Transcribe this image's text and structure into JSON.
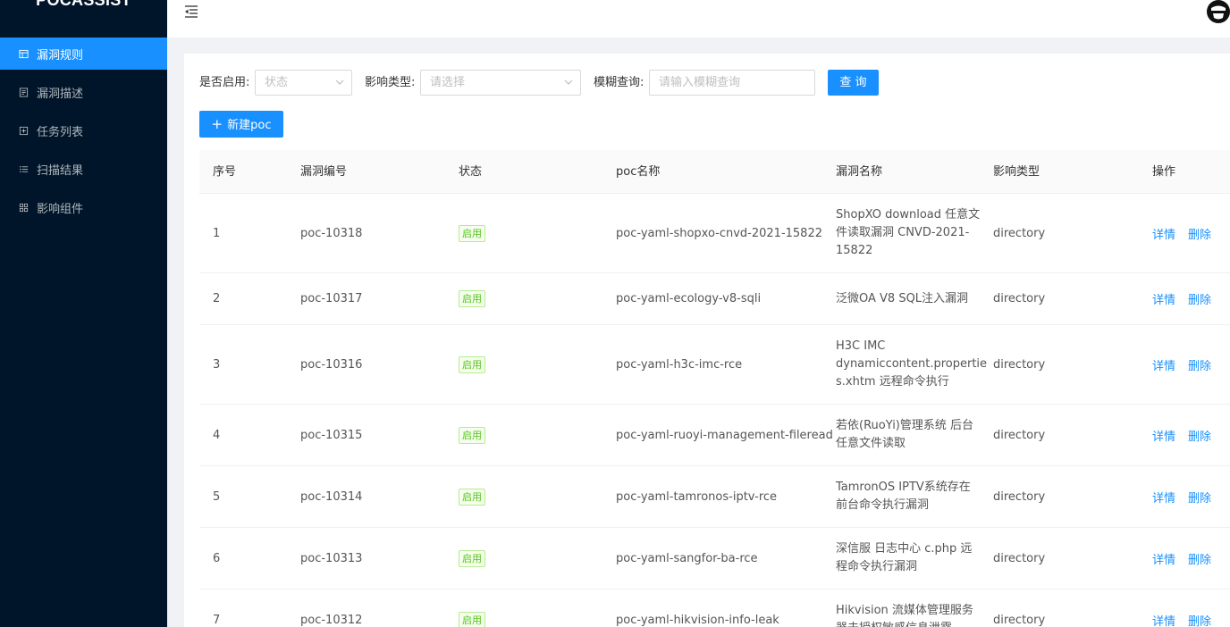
{
  "app": {
    "title": "POCASSIST"
  },
  "sidebar": {
    "items": [
      {
        "label": "漏洞规则",
        "icon": "table-icon",
        "active": true
      },
      {
        "label": "漏洞描述",
        "icon": "document-icon",
        "active": false
      },
      {
        "label": "任务列表",
        "icon": "task-icon",
        "active": false
      },
      {
        "label": "扫描结果",
        "icon": "list-icon",
        "active": false
      },
      {
        "label": "影响组件",
        "icon": "grid-icon",
        "active": false
      }
    ]
  },
  "filters": {
    "enabled_label": "是否启用:",
    "enabled_placeholder": "状态",
    "type_label": "影响类型:",
    "type_placeholder": "请选择",
    "search_label": "模糊查询:",
    "search_placeholder": "请输入模糊查询",
    "query_button": "查 询",
    "new_button": "新建poc"
  },
  "table": {
    "columns": [
      "序号",
      "漏洞编号",
      "状态",
      "poc名称",
      "漏洞名称",
      "影响类型",
      "操作"
    ],
    "action_detail": "详情",
    "action_delete": "删除",
    "rows": [
      {
        "index": "1",
        "id": "poc-10318",
        "status": "启用",
        "poc_name": "poc-yaml-shopxo-cnvd-2021-15822",
        "vuln_name_lines": [
          "ShopXO download 任意文",
          "件读取漏洞 CNVD-2021-",
          "15822"
        ],
        "type": "directory"
      },
      {
        "index": "2",
        "id": "poc-10317",
        "status": "启用",
        "poc_name": "poc-yaml-ecology-v8-sqli",
        "vuln_name_lines": [
          "泛微OA V8 SQL注入漏洞"
        ],
        "type": "directory"
      },
      {
        "index": "3",
        "id": "poc-10316",
        "status": "启用",
        "poc_name": "poc-yaml-h3c-imc-rce",
        "vuln_name_lines": [
          "H3C IMC",
          "dynamiccontent.propertie",
          "s.xhtm 远程命令执行"
        ],
        "type": "directory"
      },
      {
        "index": "4",
        "id": "poc-10315",
        "status": "启用",
        "poc_name": "poc-yaml-ruoyi-management-fileread",
        "vuln_name_lines": [
          "若依(RuoYi)管理系统 后台",
          "任意文件读取"
        ],
        "type": "directory"
      },
      {
        "index": "5",
        "id": "poc-10314",
        "status": "启用",
        "poc_name": "poc-yaml-tamronos-iptv-rce",
        "vuln_name_lines": [
          "TamronOS IPTV系统存在",
          "前台命令执行漏洞"
        ],
        "type": "directory"
      },
      {
        "index": "6",
        "id": "poc-10313",
        "status": "启用",
        "poc_name": "poc-yaml-sangfor-ba-rce",
        "vuln_name_lines": [
          "深信服 日志中心 c.php 远",
          "程命令执行漏洞"
        ],
        "type": "directory"
      },
      {
        "index": "7",
        "id": "poc-10312",
        "status": "启用",
        "poc_name": "poc-yaml-hikvision-info-leak",
        "vuln_name_lines": [
          "Hikvision 流媒体管理服务",
          "器未授权敏感信息泄露"
        ],
        "type": "directory"
      }
    ]
  },
  "colors": {
    "sidebar_bg": "#001529",
    "primary": "#1890ff",
    "tag_green": "#52c41a"
  }
}
